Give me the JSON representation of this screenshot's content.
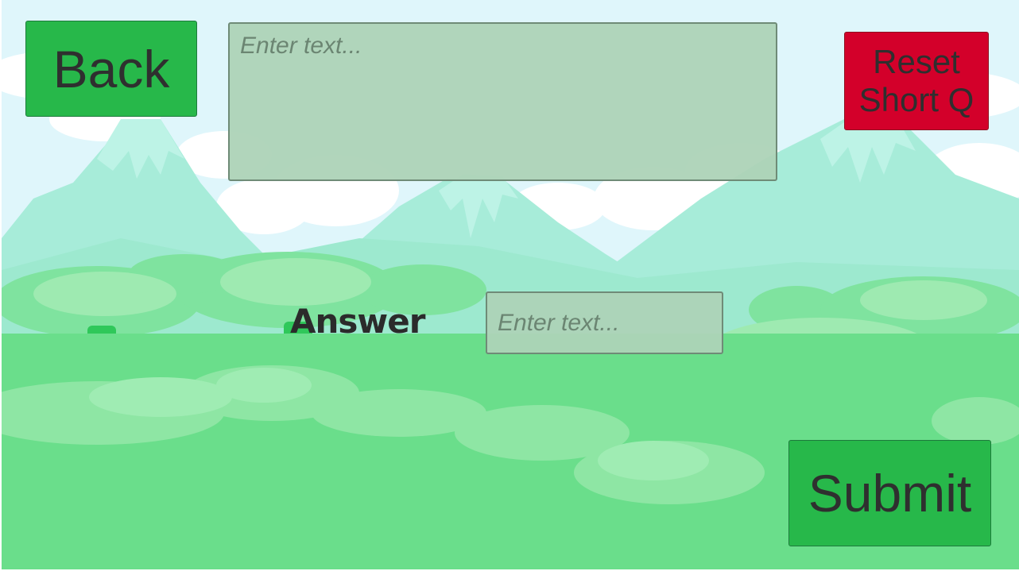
{
  "buttons": {
    "back_label": "Back",
    "reset_label": "Reset\nShort Q",
    "submit_label": "Submit"
  },
  "question": {
    "placeholder": "Enter text...",
    "value": ""
  },
  "answer": {
    "label": "Answer",
    "placeholder": "Enter text...",
    "value": ""
  },
  "icons": {
    "background": "forest-mountains-illustration"
  },
  "colors": {
    "sky": "#dff6fb",
    "mountain": "#a3ecd8",
    "forest": "#6ade8b",
    "button_green": "#27b84a",
    "button_red": "#d3002a"
  }
}
